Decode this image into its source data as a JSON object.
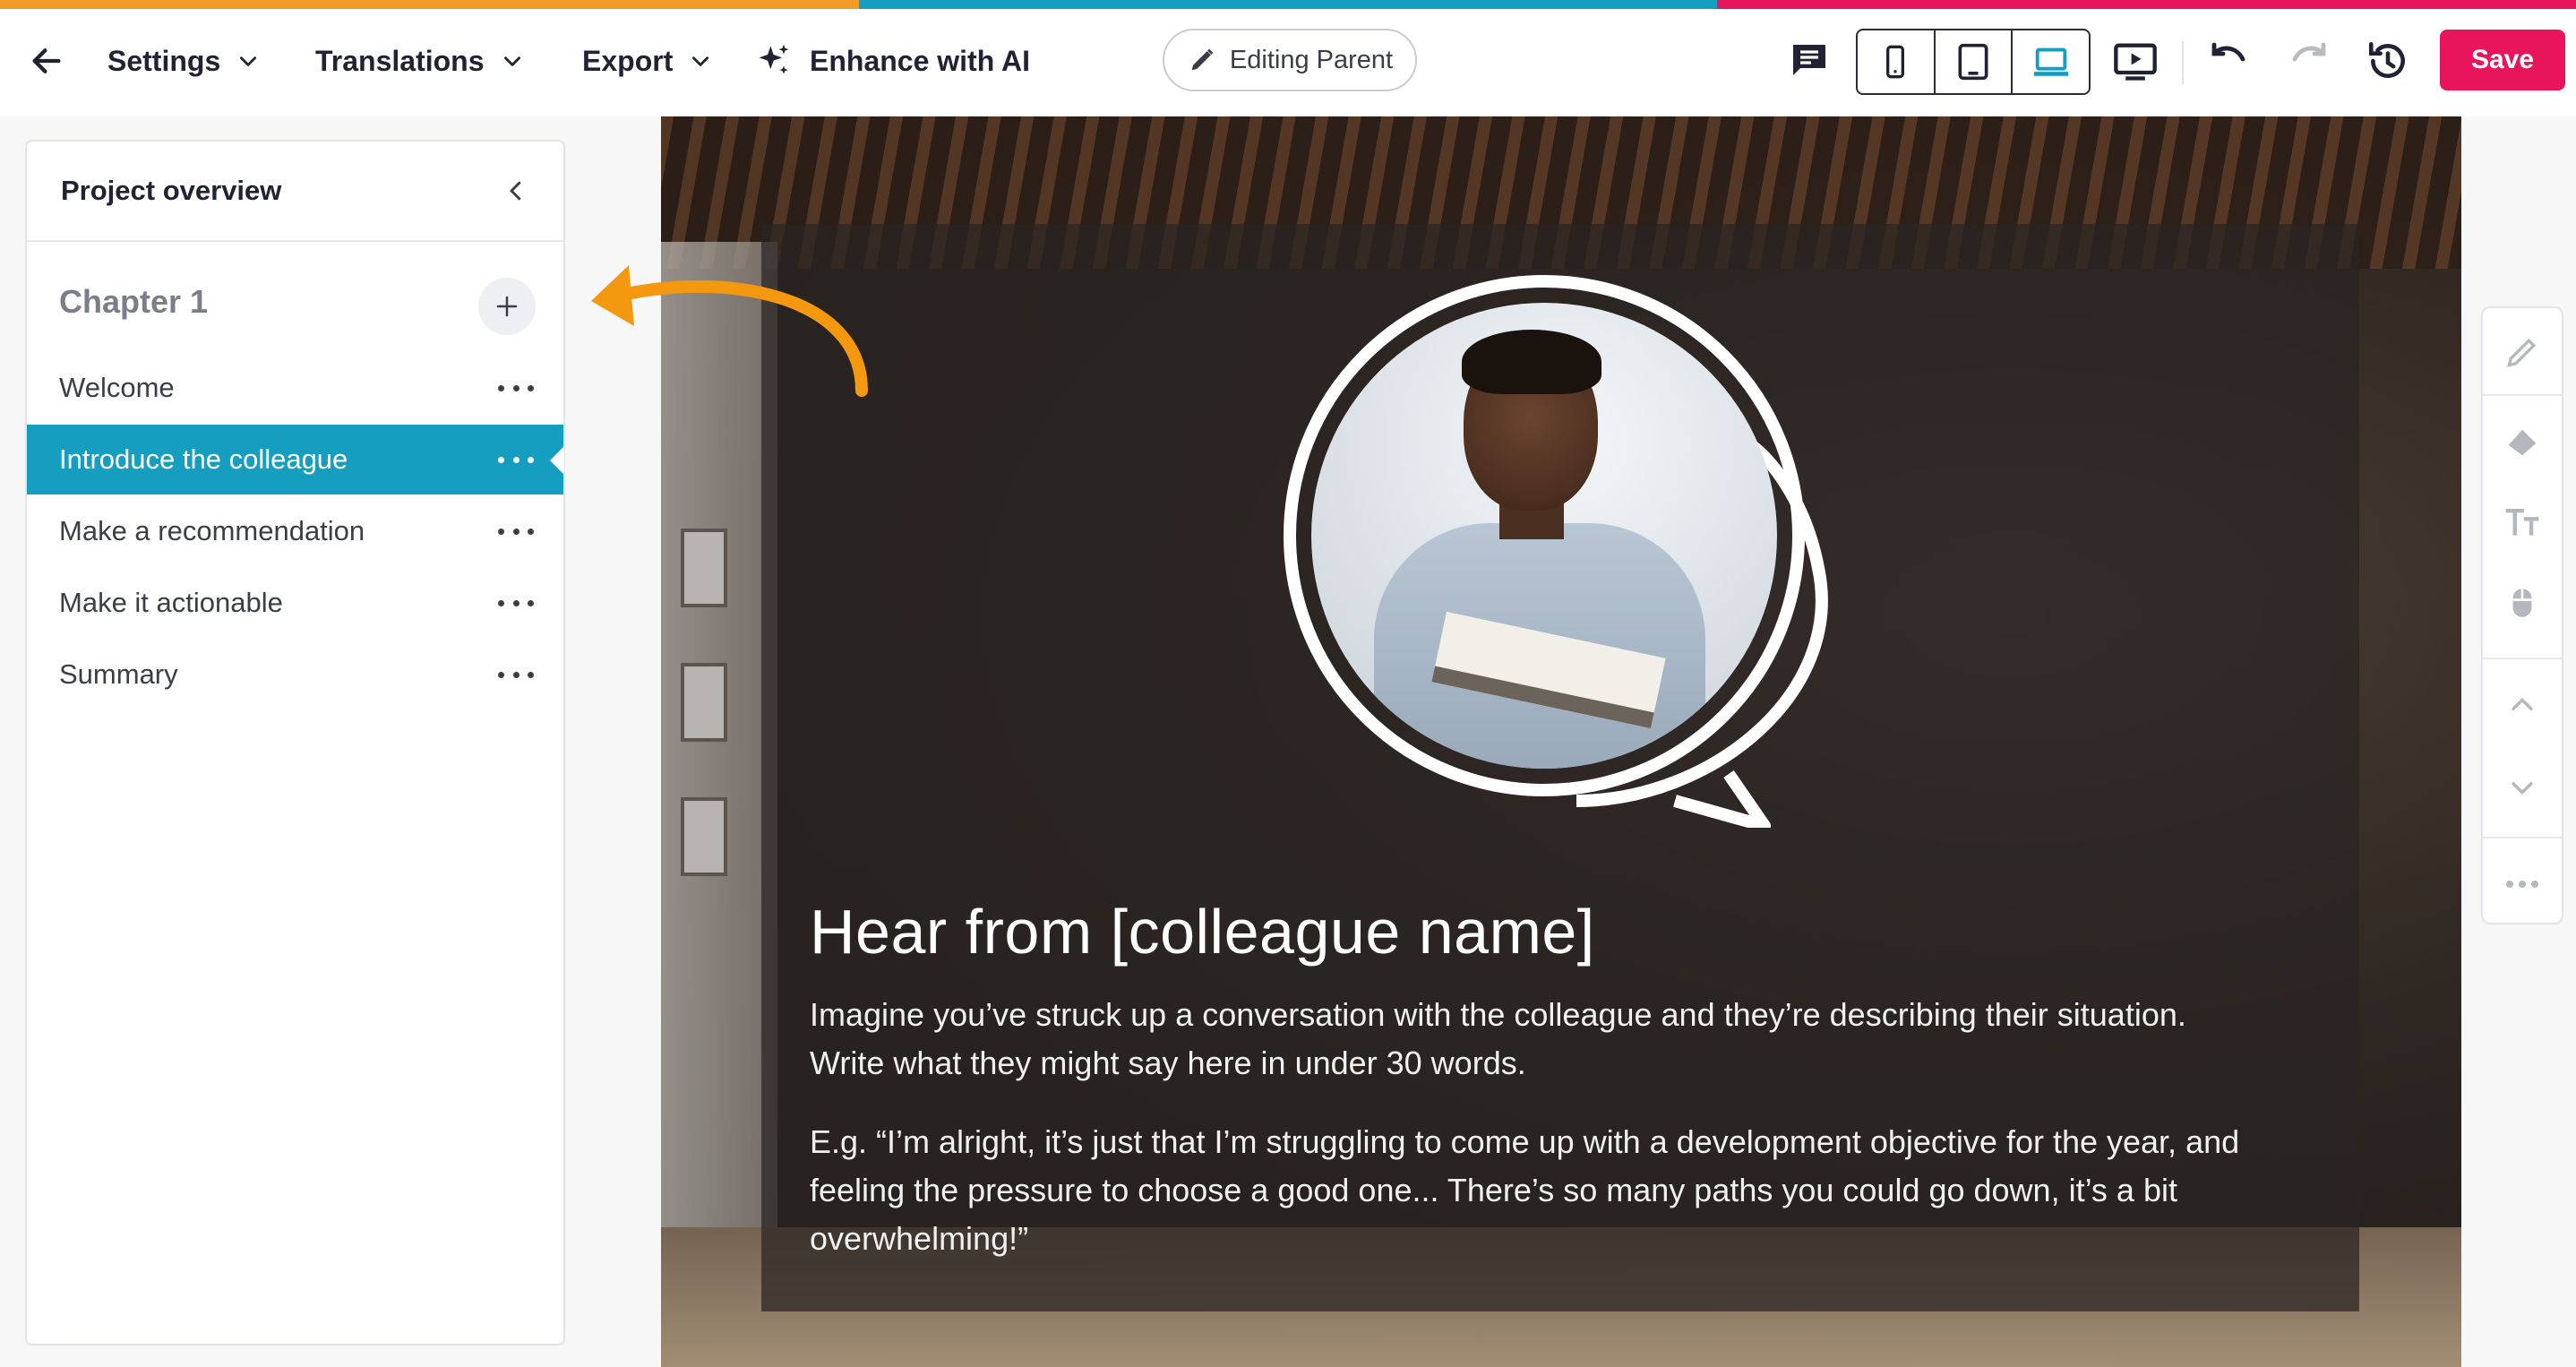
{
  "accent_colors": [
    "#f29c28",
    "#169ec1",
    "#e8145c"
  ],
  "toolbar": {
    "back_icon": "arrow-left-icon",
    "menus": [
      {
        "label": "Settings"
      },
      {
        "label": "Translations"
      },
      {
        "label": "Export"
      }
    ],
    "enhance_label": "Enhance with AI",
    "editing_label": "Editing Parent",
    "save_label": "Save",
    "icons": [
      "comment-icon",
      "mobile-icon",
      "tablet-icon",
      "laptop-icon",
      "preview-icon",
      "undo-icon",
      "redo-icon",
      "history-icon"
    ],
    "active_device": "laptop"
  },
  "sidebar": {
    "title": "Project overview",
    "chapter": "Chapter 1",
    "lessons": [
      {
        "label": "Welcome",
        "active": false
      },
      {
        "label": "Introduce the colleague",
        "active": true
      },
      {
        "label": "Make a recommendation",
        "active": false
      },
      {
        "label": "Make it actionable",
        "active": false
      },
      {
        "label": "Summary",
        "active": false
      }
    ]
  },
  "slide": {
    "title": "Hear from [colleague name]",
    "paragraph1_line1": "Imagine you’ve struck up a conversation with the colleague and they’re describing their situation.",
    "paragraph1_line2": "Write what they might say here in under 30 words.",
    "paragraph2_line1": "E.g. “I’m alright, it’s just that I’m struggling to come up with a development objective for the year, and",
    "paragraph2_line2": "feeling the pressure to choose a good one... There’s so many paths you could go down, it’s a bit",
    "paragraph2_line3": "overwhelming!”"
  },
  "side_tools": [
    "pencil-icon",
    "paint-bucket-icon",
    "text-size-icon",
    "mouse-icon",
    "chevron-up-icon",
    "chevron-down-icon",
    "more-icon"
  ],
  "annotation_color": "#f4980f"
}
